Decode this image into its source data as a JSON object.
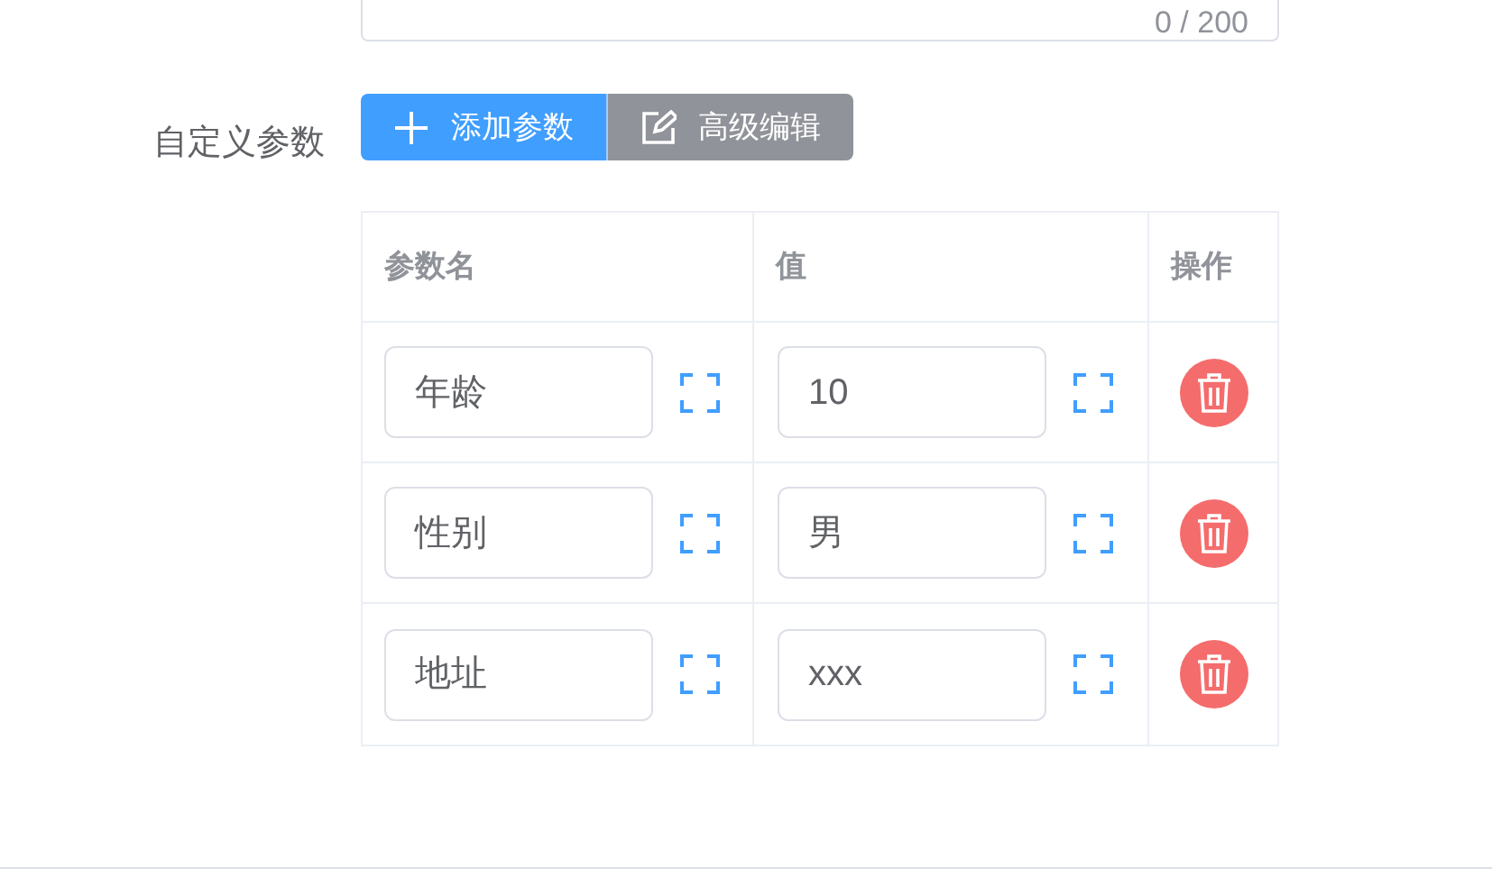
{
  "textarea": {
    "counter": "0 / 200"
  },
  "custom_params": {
    "label": "自定义参数",
    "buttons": [
      {
        "kind": "add",
        "label": "添加参数"
      },
      {
        "kind": "edit",
        "label": "高级编辑"
      }
    ],
    "table": {
      "columns": [
        "参数名",
        "值",
        "操作"
      ],
      "rows": [
        {
          "name": "年龄",
          "value": "10"
        },
        {
          "name": "性别",
          "value": "男"
        },
        {
          "name": "地址",
          "value": "xxx"
        }
      ]
    }
  }
}
